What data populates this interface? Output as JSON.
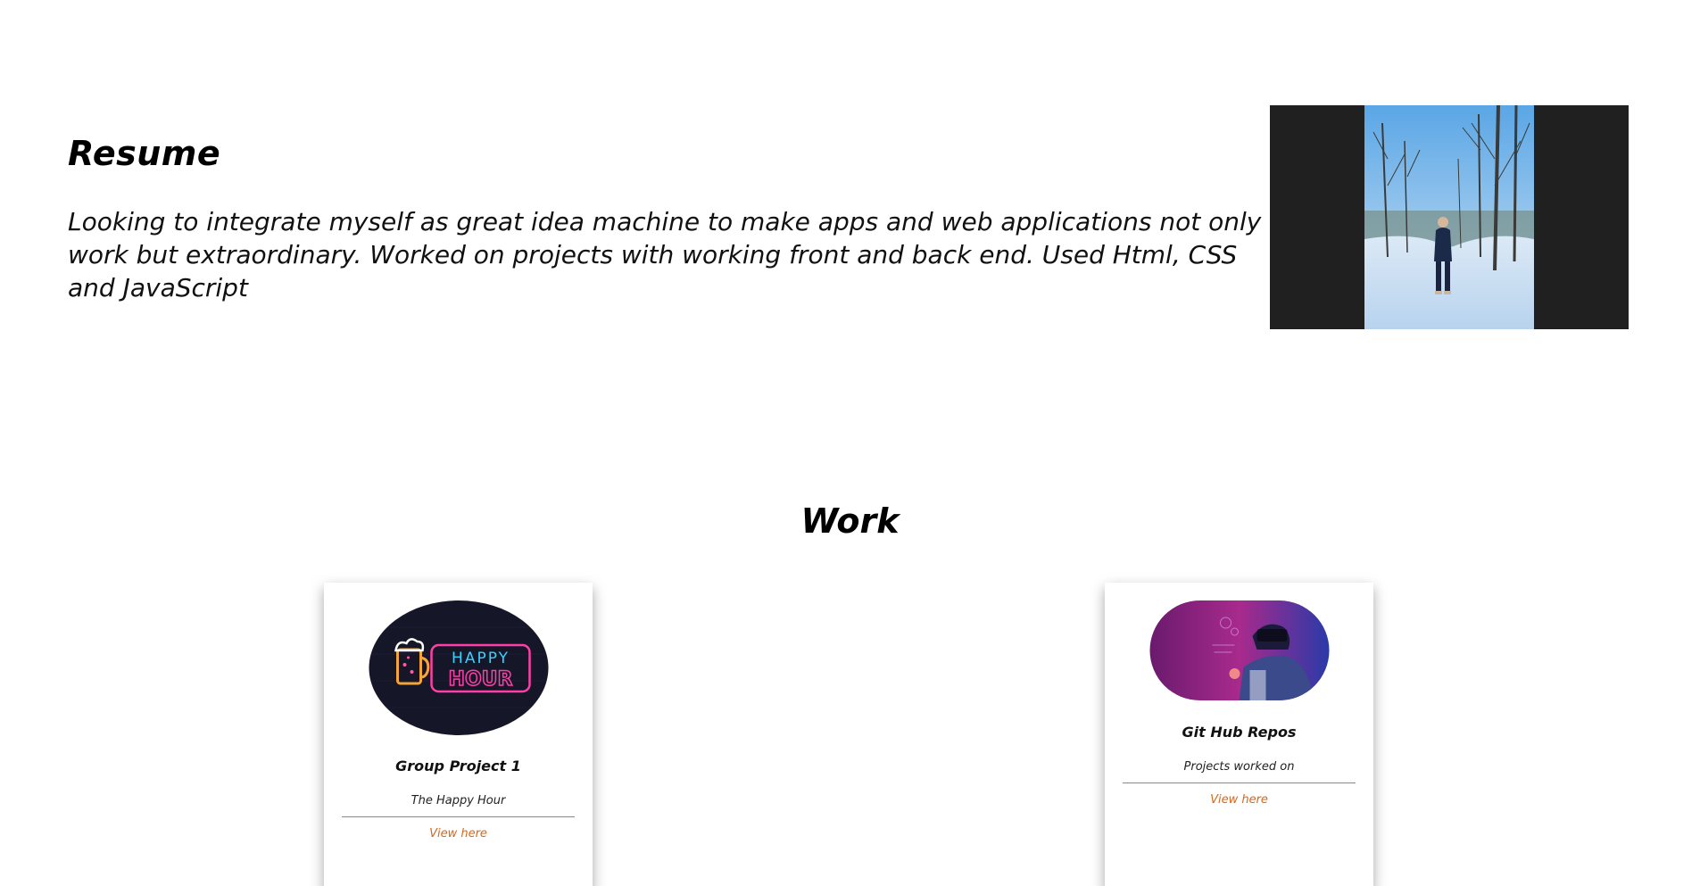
{
  "resume": {
    "title": "Resume",
    "text": "Looking to integrate myself as great idea machine to make apps and web applications not only work but extraordinary. Worked on projects with working front and back end. Used Html, CSS and JavaScript"
  },
  "work": {
    "title": "Work",
    "cards": [
      {
        "title": "Group Project 1",
        "subtitle": "The Happy Hour",
        "link": "View here",
        "image_text_top": "HAPPY",
        "image_text_bottom": "HOUR"
      },
      {
        "title": "Git Hub Repos",
        "subtitle": "Projects worked on",
        "link": "View here"
      }
    ]
  },
  "colors": {
    "link": "#d4661c",
    "photo_frame": "#202020"
  }
}
